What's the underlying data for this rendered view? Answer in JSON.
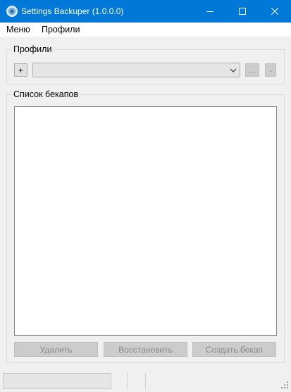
{
  "window": {
    "title": "Settings Backuper (1.0.0.0)",
    "icon": "app-disc-icon",
    "controls": {
      "minimize": "minimize-icon",
      "maximize": "maximize-icon",
      "close": "close-icon"
    },
    "accent_color": "#0078d7"
  },
  "menu": {
    "items": [
      {
        "label": "Меню"
      },
      {
        "label": "Профили"
      }
    ]
  },
  "profiles": {
    "group_label": "Профили",
    "add_label": "+",
    "selected_value": "",
    "more_label": "...",
    "remove_label": "-"
  },
  "backups": {
    "group_label": "Список бекапов",
    "items": [],
    "delete_label": "Удалить",
    "restore_label": "Восстановить",
    "create_label": "Создать бекап"
  },
  "status": {
    "progress": 0
  }
}
